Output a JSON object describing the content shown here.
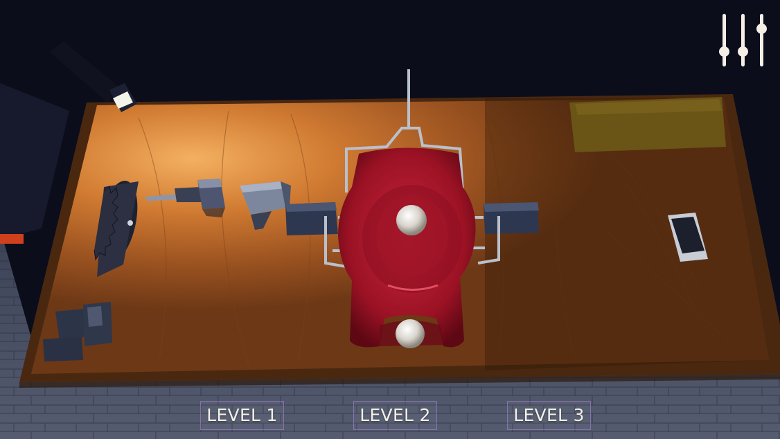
{
  "level_select": {
    "levels": [
      {
        "label": "LEVEL 1"
      },
      {
        "label": "LEVEL 2"
      },
      {
        "label": "LEVEL 3"
      }
    ]
  },
  "settings": {
    "icon": "sliders-icon",
    "slider_levels": [
      0.75,
      0.75,
      0.3
    ]
  },
  "scene": {
    "objects": [
      "flashlight",
      "circular-saw-blade",
      "screwdriver",
      "hammer-head",
      "vise-block",
      "red-fixture-jig",
      "smartphone",
      "yellow-box"
    ],
    "colors": {
      "table_wood": "#b86a2e",
      "jig_red": "#a8122a",
      "floor": "#4a5064",
      "background": "#0a0c18"
    }
  }
}
